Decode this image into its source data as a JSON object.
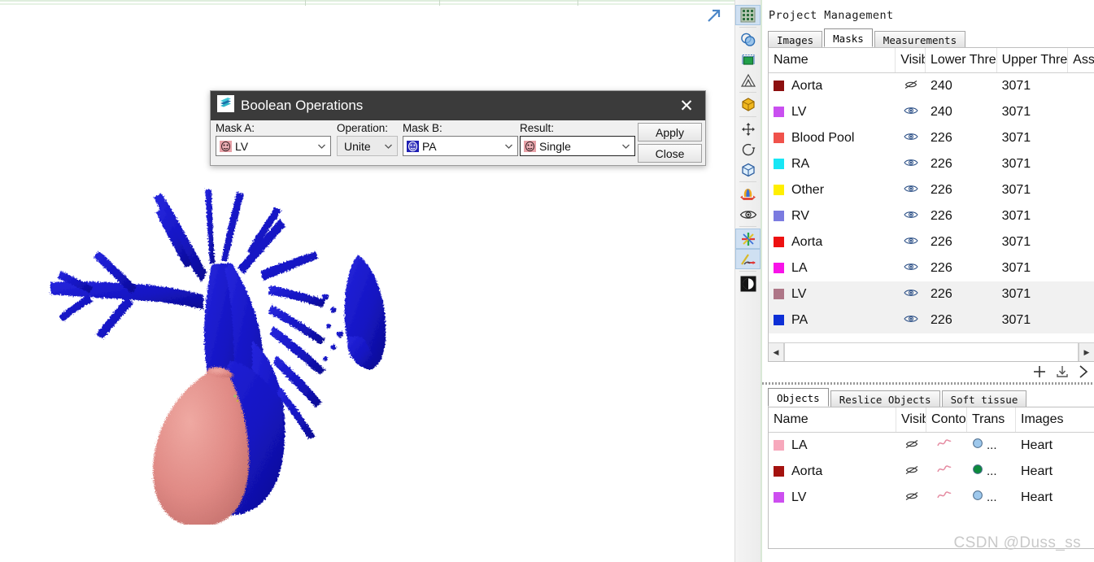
{
  "viewport": {
    "expand_icon": "expand-arrow-icon",
    "model_caption": "3d-heart-model"
  },
  "toolbar": {
    "items": [
      {
        "name": "grid-icon",
        "selected": true
      },
      {
        "name": "boolean-operations-icon",
        "selected": false
      },
      {
        "name": "crop-mask-icon",
        "selected": false
      },
      {
        "name": "triangle-reduce-icon",
        "selected": false
      },
      {
        "name": "wrap-icon",
        "selected": false
      },
      {
        "name": "move-icon",
        "selected": false
      },
      {
        "name": "rotate-icon",
        "selected": false
      },
      {
        "name": "box-icon",
        "selected": false
      },
      {
        "name": "split-mask-icon",
        "selected": false
      },
      {
        "name": "visibility-icon",
        "selected": false
      },
      {
        "name": "axis-cross-icon",
        "selected": true
      },
      {
        "name": "axis-arrow-icon",
        "selected": true
      },
      {
        "name": "contrast-icon",
        "selected": false
      }
    ]
  },
  "dock": {
    "title": "Project Management",
    "masks_panel": {
      "tabs": [
        {
          "label": "Images",
          "active": false
        },
        {
          "label": "Masks",
          "active": true
        },
        {
          "label": "Measurements",
          "active": false
        }
      ],
      "columns": [
        "Name",
        "Visib",
        "Lower Thre",
        "Upper Thre",
        "Asse"
      ],
      "rows": [
        {
          "color": "#8c0f0f",
          "name": "Aorta",
          "visible": false,
          "lower": "240",
          "upper": "3071",
          "selected": false
        },
        {
          "color": "#c94ff0",
          "name": "LV",
          "visible": true,
          "lower": "240",
          "upper": "3071",
          "selected": false
        },
        {
          "color": "#f0524b",
          "name": "Blood Pool",
          "visible": true,
          "lower": "226",
          "upper": "3071",
          "selected": false
        },
        {
          "color": "#17e6f5",
          "name": "RA",
          "visible": true,
          "lower": "226",
          "upper": "3071",
          "selected": false
        },
        {
          "color": "#ffef00",
          "name": "Other",
          "visible": true,
          "lower": "226",
          "upper": "3071",
          "selected": false
        },
        {
          "color": "#7b7be0",
          "name": "RV",
          "visible": true,
          "lower": "226",
          "upper": "3071",
          "selected": false
        },
        {
          "color": "#ed1111",
          "name": "Aorta",
          "visible": true,
          "lower": "226",
          "upper": "3071",
          "selected": false
        },
        {
          "color": "#f813e8",
          "name": "LA",
          "visible": true,
          "lower": "226",
          "upper": "3071",
          "selected": false
        },
        {
          "color": "#ae7687",
          "name": "LV",
          "visible": true,
          "lower": "226",
          "upper": "3071",
          "selected": true
        },
        {
          "color": "#0d2fd6",
          "name": "PA",
          "visible": true,
          "lower": "226",
          "upper": "3071",
          "selected": true
        }
      ],
      "actions": [
        {
          "name": "add-mask-icon",
          "label": "+"
        },
        {
          "name": "import-mask-icon",
          "label": "download"
        },
        {
          "name": "more-actions-icon",
          "label": ">"
        }
      ]
    },
    "objects_panel": {
      "tabs": [
        {
          "label": "Objects",
          "active": true
        },
        {
          "label": "Reslice Objects",
          "active": false
        },
        {
          "label": "Soft tissue",
          "active": false
        }
      ],
      "columns": [
        "Name",
        "Visib",
        "Conto",
        "Trans",
        "Images"
      ],
      "rows": [
        {
          "color": "#f7a8bc",
          "name": "LA",
          "visible": false,
          "contour": "#e58aa0",
          "trans_color": "#9ec8ec",
          "trans": "...",
          "images": "Heart"
        },
        {
          "color": "#a4120f",
          "name": "Aorta",
          "visible": false,
          "contour": "#e58aa0",
          "trans_color": "#0c8a3c",
          "trans": "...",
          "images": "Heart"
        },
        {
          "color": "#cd4ef0",
          "name": "LV",
          "visible": false,
          "contour": "#e58aa0",
          "trans_color": "#9ec8ec",
          "trans": "...",
          "images": "Heart"
        }
      ]
    }
  },
  "dialog": {
    "title": "Boolean Operations",
    "title_icon": "boolean-operations-icon",
    "close_label": "✕",
    "fields": {
      "mask_a": {
        "label": "Mask A:",
        "value": "LV",
        "icon_color": "#e8a2a8"
      },
      "operation": {
        "label": "Operation:",
        "value": "Unite"
      },
      "mask_b": {
        "label": "Mask B:",
        "value": "PA",
        "icon_color": "#1f1fb4"
      },
      "result": {
        "label": "Result:",
        "value": "Single",
        "icon_color": "#e8a2a8"
      }
    },
    "buttons": {
      "apply": "Apply",
      "close": "Close"
    }
  },
  "watermark": "CSDN @Duss_ss",
  "colors": {
    "dialog_titlebar": "#3b3b3b",
    "selection": "#cfe0f2",
    "row_selected": "#f1f1f1",
    "model_blue": "#1414c8",
    "model_pink": "#e08a85"
  }
}
